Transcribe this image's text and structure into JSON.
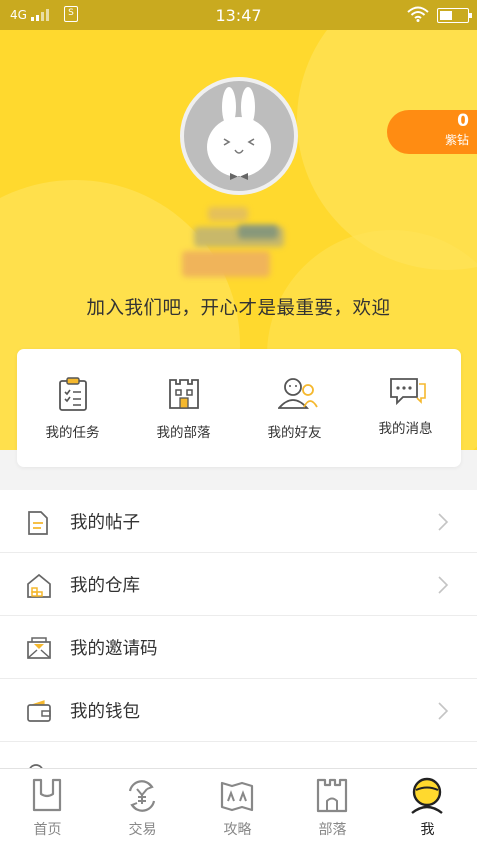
{
  "status_bar": {
    "network": "4G",
    "sim_icon": "S",
    "time": "13:47",
    "wifi_icon": "wifi-icon",
    "battery_icon": "battery-icon"
  },
  "profile": {
    "avatar_icon": "rabbit-avatar-icon",
    "diamond_count": "0",
    "diamond_label": "紫钻",
    "slogan": "加入我们吧，开心才是最重要，欢迎"
  },
  "quick_actions": [
    {
      "label": "我的任务",
      "icon": "task-clipboard-icon"
    },
    {
      "label": "我的部落",
      "icon": "castle-icon"
    },
    {
      "label": "我的好友",
      "icon": "friends-icon"
    },
    {
      "label": "我的消息",
      "icon": "message-icon"
    }
  ],
  "menu": [
    {
      "label": "我的帖子",
      "icon": "post-document-icon"
    },
    {
      "label": "我的仓库",
      "icon": "warehouse-icon"
    },
    {
      "label": "我的邀请码",
      "icon": "invite-envelope-icon"
    },
    {
      "label": "我的钱包",
      "icon": "wallet-icon"
    }
  ],
  "tabbar": [
    {
      "label": "首页",
      "icon": "home-tab-icon",
      "active": false
    },
    {
      "label": "交易",
      "icon": "trade-yen-icon",
      "active": false
    },
    {
      "label": "攻略",
      "icon": "guide-map-icon",
      "active": false
    },
    {
      "label": "部落",
      "icon": "tribe-castle-icon",
      "active": false
    },
    {
      "label": "我",
      "icon": "profile-face-icon",
      "active": true
    }
  ],
  "colors": {
    "brand_yellow": "#ffd92e",
    "badge_orange": "#ff8c12",
    "icon_gray": "#666666"
  }
}
